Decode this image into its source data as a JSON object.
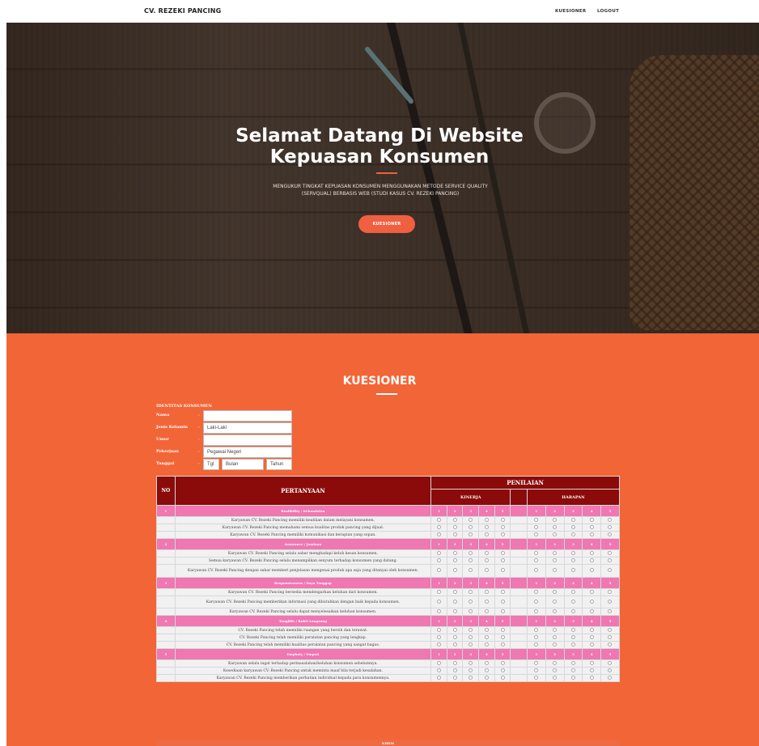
{
  "nav": {
    "brand": "CV. REZEKI PANCING",
    "links": [
      "KUESIONER",
      "LOGOUT"
    ]
  },
  "hero": {
    "title_line1": "Selamat Datang Di Website",
    "title_line2": "Kepuasan Konsumen",
    "subtitle_line1": "MENGUKUR TINGKAT KEPUASAN KONSUMEN MENGGUNAKAN METODE SERVICE QUALITY",
    "subtitle_line2": "(SERVQUAL) BERBASIS WEB (STUDI KASUS CV. REZEKI PANCING)",
    "button": "KUESIONER"
  },
  "kuesioner": {
    "title": "KUESIONER",
    "identity": {
      "title": "IDENTITAS KONSUMEN",
      "fields": [
        {
          "label": "Nama",
          "value": ""
        },
        {
          "label": "Jenis Kelamin",
          "value": "Laki-Laki"
        },
        {
          "label": "Umur",
          "value": ""
        },
        {
          "label": "Pekerjaan",
          "value": "Pegawai Negeri"
        },
        {
          "label": "Tanggal",
          "value": ""
        }
      ],
      "date_placeholders": [
        "Tgl",
        "Bulan",
        "Tahun"
      ]
    },
    "table": {
      "headers": {
        "no": "NO",
        "question": "PERTANYAAN",
        "rating": "PENILAIAN",
        "kinerja": "KINERJA",
        "harapan": "HARAPAN"
      },
      "scale": [
        "1",
        "2",
        "3",
        "4",
        "5"
      ],
      "categories": [
        {
          "no": "1",
          "name": "Realibility / Kehandalan",
          "questions": [
            "Karyawan CV. Rezeki Pancing memiliki keahlian dalam melayani konsumen.",
            "Karyawan CV. Rezeki Pancing memahami semua kualitas produk pancing yang dijual.",
            "Karyawan CV. Rezeki Pancing memiliki komunikasi dan kerapian yang sopan."
          ]
        },
        {
          "no": "2",
          "name": "Assurance / Jaminan",
          "questions": [
            "Karyawan CV. Rezeki Pancing selalu sabar menghadapi keluh kesan konsumen.",
            "Semua karyawan CV. Rezeki Pancing selalu menampilkan senyum terhadap konsumen yang datang.",
            "Karyawan CV. Rezeki Pancing dengan sabar memberi penjelasan mengenai produk apa saja yang ditanyai oleh konsumen."
          ]
        },
        {
          "no": "3",
          "name": "Responsiveness / Daya Tanggap",
          "questions": [
            "Karyawan CV. Rezeki Pancing bersedia mendengarkan keluhan dari konsumen.",
            "Karyawan CV. Rezeki Pancing memberikan informasi yang dibutuhkan dengan baik kepada konsumen.",
            "Karyawan CV. Rezeki Pancing selalu dapat menyelesaikan keluhan konsumen."
          ]
        },
        {
          "no": "4",
          "name": "Tangible / Bukti Langsung",
          "questions": [
            "CV. Rezeki Pancing telah memiliki ruangan yang bersih dan terawat.",
            "CV. Rezeki Pancing telah memiliki peralatan pancing yang lengkap.",
            "CV. Rezeki Pancing telah memiliki kualitas peralatan pancing yang sangat bagus."
          ]
        },
        {
          "no": "5",
          "name": "Emphaty / Empati",
          "questions": [
            "Karyawan selalu ingat terhadap permasalahan/keluhan konsumen sebelumnya.",
            "Kesediaan karyawan CV. Rezeki Pancing untuk meminta maaf bila terjadi kesalahan.",
            "Karyawan CV. Rezeki Pancing memberikan perhatian individual kepada para konsumennya."
          ]
        }
      ]
    },
    "submit": "KIRIM"
  }
}
